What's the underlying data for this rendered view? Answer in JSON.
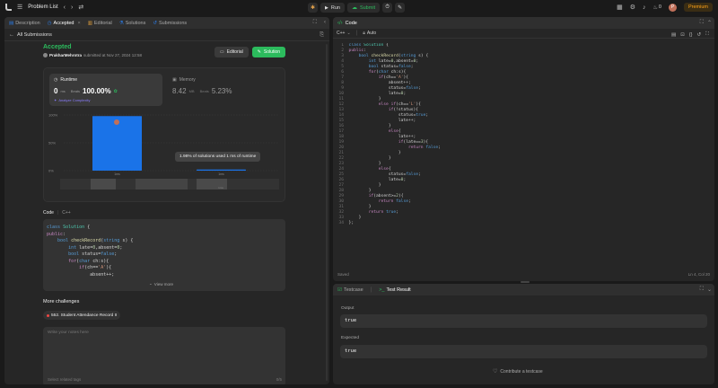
{
  "topbar": {
    "logo_icon": "leetcode-logo",
    "problem_list": "Problem List",
    "run_label": "Run",
    "submit_label": "Submit",
    "premium_label": "Premium",
    "streak_count": "0",
    "avatar_letter": "P"
  },
  "left_tabs": [
    {
      "label": "Description"
    },
    {
      "label": "Accepted"
    },
    {
      "label": "Editorial"
    },
    {
      "label": "Solutions"
    },
    {
      "label": "Submissions"
    }
  ],
  "back_link": "All Submissions",
  "submission": {
    "status": "Accepted",
    "user": "PrakharMehrotra",
    "submitted_text": "submitted at Nov 27, 2024 12:58",
    "editorial_btn": "Editorial",
    "solution_btn": "Solution"
  },
  "runtime": {
    "title": "Runtime",
    "value": "0",
    "unit": "ms",
    "beats_label": "Beats",
    "beats_value": "100.00%",
    "analyze": "Analyze Complexity"
  },
  "memory": {
    "title": "Memory",
    "value": "8.42",
    "unit": "MB",
    "beats_label": "Beats",
    "beats_value": "5.23%"
  },
  "chart_data": {
    "type": "bar",
    "yticks": [
      "100%",
      "50%",
      "0%"
    ],
    "ylim": [
      0,
      100
    ],
    "categories": [
      "1ms",
      "1ms"
    ],
    "values": [
      98,
      2
    ],
    "tooltip": "1.98% of solutions used 1 ms of runtime",
    "x_labels": [
      "1ms",
      "1ms"
    ]
  },
  "code_section": {
    "label": "Code",
    "lang": "C++",
    "view_more": "View more"
  },
  "preview_code": [
    "class Solution {",
    "public:",
    "    bool checkRecord(string s) {",
    "        int late=0,absent=0;",
    "        bool status=false;",
    "        for(char ch:s){",
    "            if(ch=='A'){",
    "                absent++;"
  ],
  "more_challenges": {
    "title": "More challenges",
    "item": "552. Student Attendance Record II"
  },
  "notes": {
    "placeholder": "Write your notes here",
    "related_placeholder": "Select related tags",
    "count": "0/5"
  },
  "code_panel": {
    "title": "Code",
    "lang": "C++",
    "auto": "Auto",
    "saved": "Saved",
    "cursor": "Ln 4, Col 20"
  },
  "editor_code": [
    "class Solution {",
    "public:",
    "    bool checkRecord(string s) {",
    "        int late=0,absent=0;",
    "        bool status=false;",
    "        for(char ch:s){",
    "            if(ch=='A'){",
    "                absent++;",
    "                status=false;",
    "                late=0;",
    "            }",
    "            else if(ch=='L'){",
    "                if(!status){",
    "                    status=true;",
    "                    late++;",
    "                }",
    "                else{",
    "                    late++;",
    "                    if(late==3){",
    "                        return false;",
    "                    }",
    "                }",
    "            }",
    "            else{",
    "                status=false;",
    "                late=0;",
    "            }",
    "        }",
    "        if(absent>=2){",
    "            return false;",
    "        }",
    "        return true;",
    "    }",
    "};"
  ],
  "bottom_panel": {
    "tab_testcase": "Testcase",
    "tab_result": "Test Result",
    "output_label": "Output",
    "output_value": "true",
    "expected_label": "Expected",
    "expected_value": "true",
    "contribute": "Contribute a testcase"
  },
  "colors": {
    "accent_green": "#2cbb5d",
    "bar_blue": "#1a73e8",
    "premium": "#ffa116"
  }
}
